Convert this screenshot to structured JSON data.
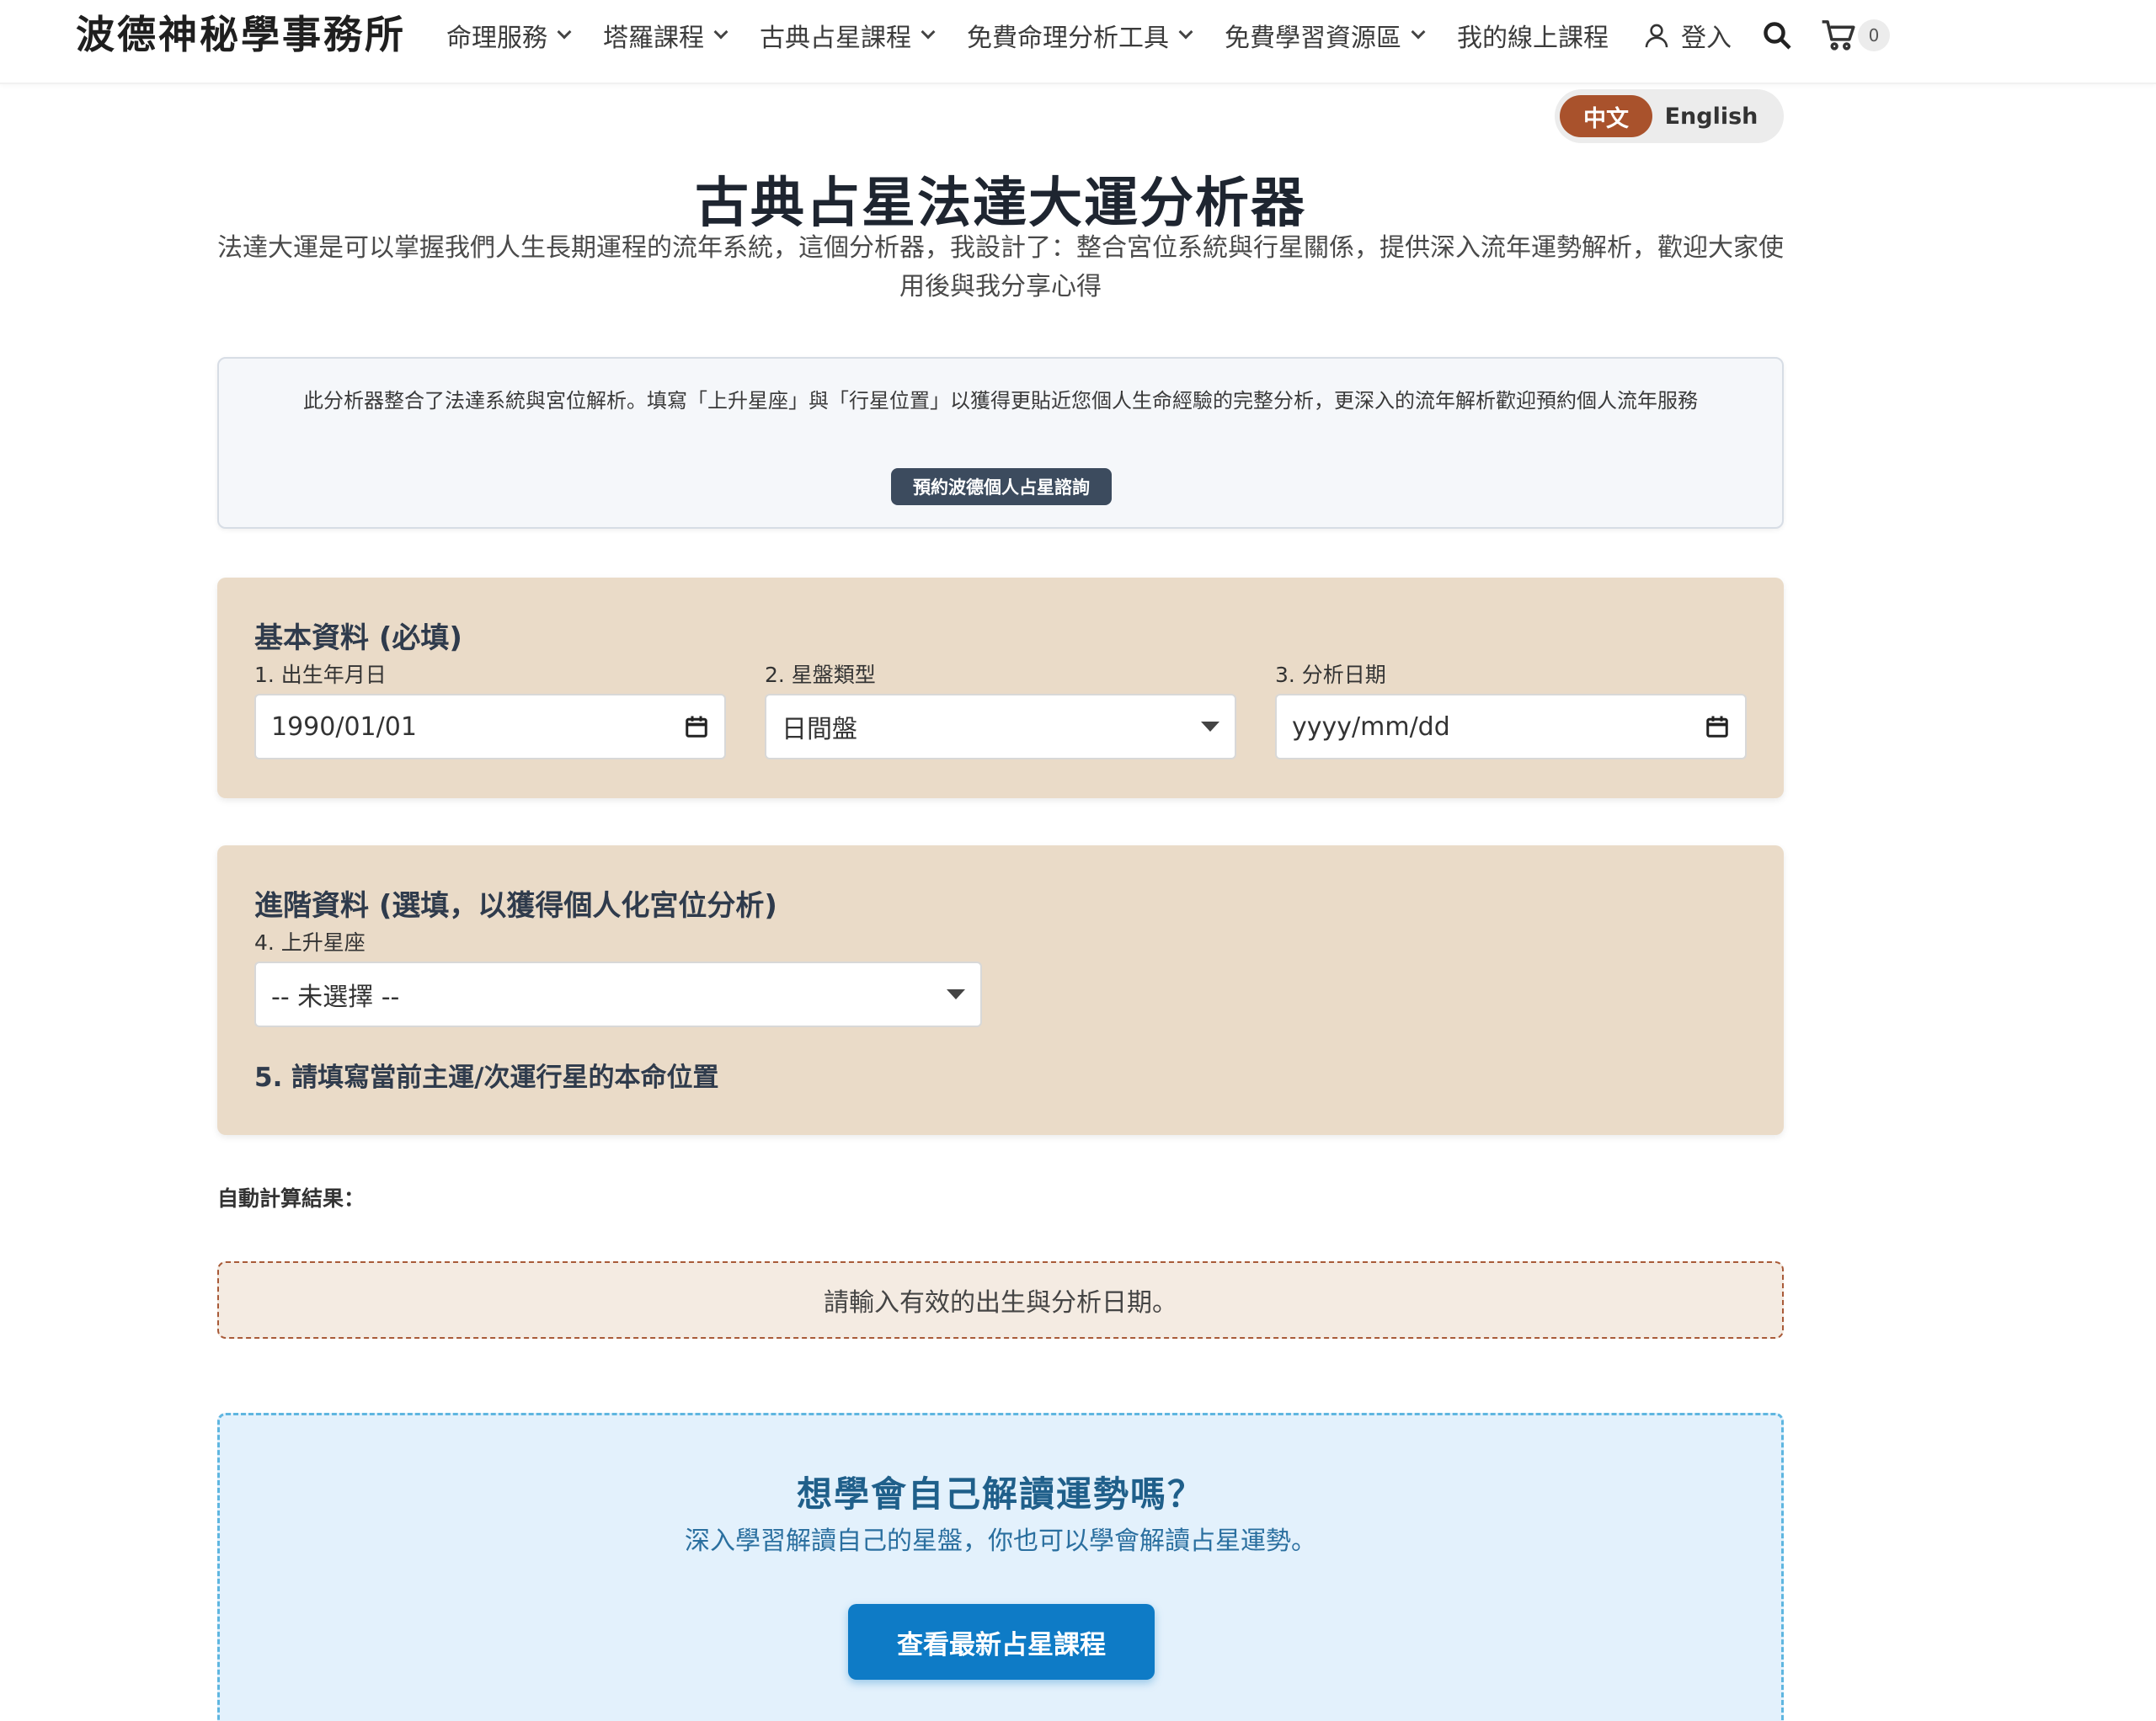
{
  "header": {
    "logo": "波德神秘學事務所",
    "nav": [
      {
        "label": "命理服務",
        "dropdown": true
      },
      {
        "label": "塔羅課程",
        "dropdown": true
      },
      {
        "label": "古典占星課程",
        "dropdown": true
      },
      {
        "label": "免費命理分析工具",
        "dropdown": true
      },
      {
        "label": "免費學習資源區",
        "dropdown": true
      },
      {
        "label": "我的線上課程",
        "dropdown": false
      }
    ],
    "login_label": "登入",
    "cart_count": "0"
  },
  "lang": {
    "zh": "中文",
    "en": "English",
    "active": "zh"
  },
  "page": {
    "title": "古典占星法達大運分析器",
    "intro": "法達大運是可以掌握我們人生長期運程的流年系統，這個分析器，我設計了：整合宮位系統與行星關係，提供深入流年運勢解析，歡迎大家使用後與我分享心得"
  },
  "notice": {
    "text": "此分析器整合了法達系統與宮位解析。填寫「上升星座」與「行星位置」以獲得更貼近您個人生命經驗的完整分析，更深入的流年解析歡迎預約個人流年服務",
    "button": "預約波德個人占星諮詢"
  },
  "basic": {
    "title": "基本資料 (必填)",
    "birth_label": "1. 出生年月日",
    "birth_value": "1990/01/01",
    "chart_label": "2. 星盤類型",
    "chart_value": "日間盤",
    "date_label": "3. 分析日期",
    "date_placeholder": "yyyy/mm/dd"
  },
  "advanced": {
    "title": "進階資料 (選填，以獲得個人化宮位分析)",
    "asc_label": "4. 上升星座",
    "asc_value": "-- 未選擇 --",
    "planet_title": "5. 請填寫當前主運/次運行星的本命位置"
  },
  "result": {
    "label": "自動計算結果：",
    "message": "請輸入有效的出生與分析日期。"
  },
  "promo": {
    "title": "想學會自己解讀運勢嗎？",
    "subtitle": "深入學習解讀自己的星盤，你也可以學會解讀占星運勢。",
    "button": "查看最新占星課程"
  },
  "colors": {
    "accent": "#a9522c",
    "card_bg": "#eadbc8",
    "promo_bg": "#e3f1fc",
    "promo_button": "#0e7bc6"
  },
  "icons": [
    "chevron-down-icon",
    "user-icon",
    "search-icon",
    "cart-icon",
    "calendar-icon",
    "dropdown-arrow-icon"
  ]
}
